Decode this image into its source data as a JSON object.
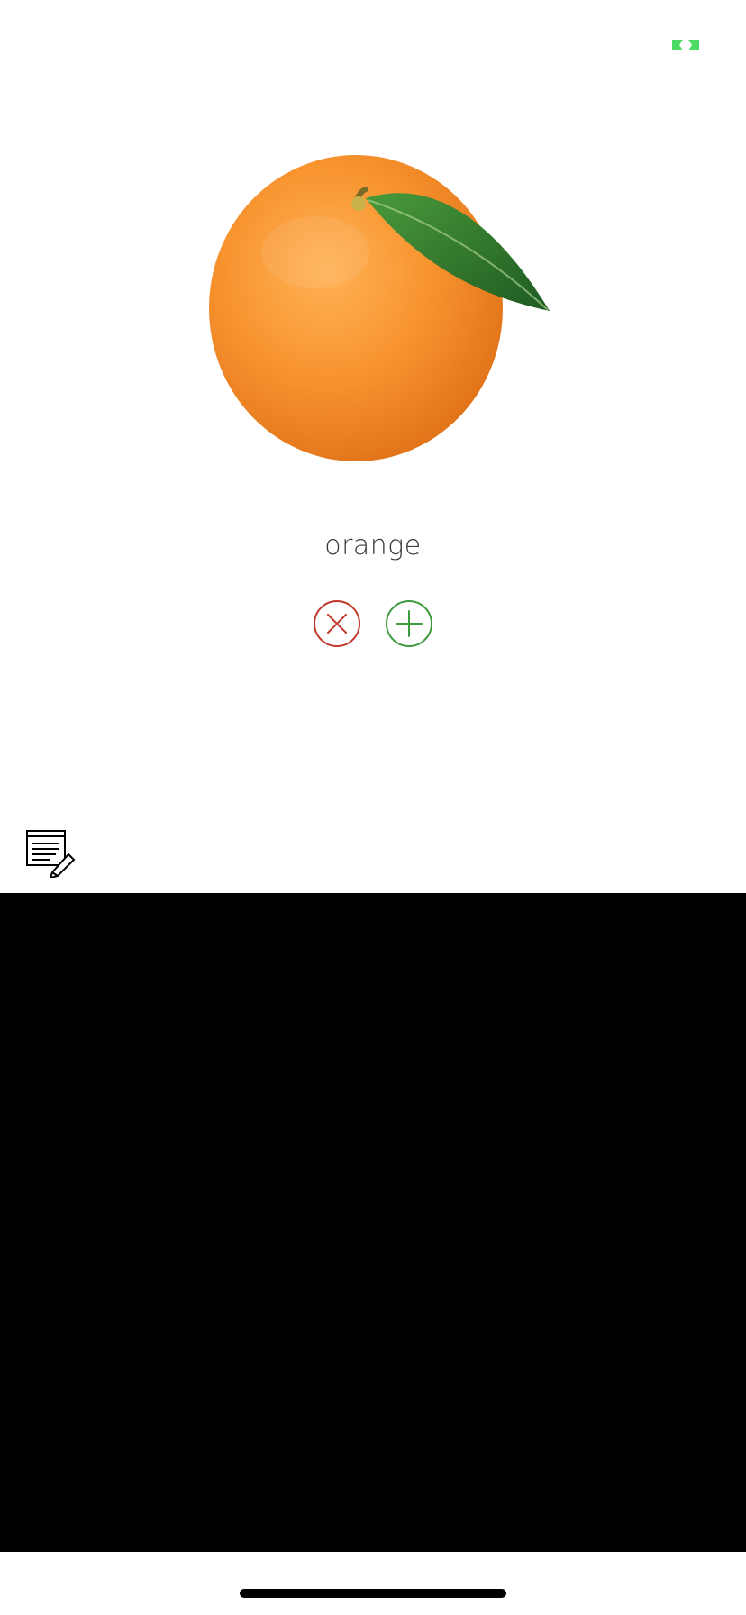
{
  "flashcard": {
    "word": "orange",
    "image_subject": "orange-fruit-with-leaf"
  },
  "actions": {
    "reject_icon": "close-circle-icon",
    "add_icon": "plus-circle-icon"
  },
  "toolbar": {
    "notes_icon": "edit-list-icon"
  },
  "status": {
    "badge_icon": "camera-badge-icon"
  },
  "colors": {
    "reject": "#c0392b",
    "add": "#3e9a3e",
    "badge": "#4cd964",
    "orange": "#f7932e",
    "leaf": "#2e7d32",
    "keyboard_area": "#000000"
  }
}
